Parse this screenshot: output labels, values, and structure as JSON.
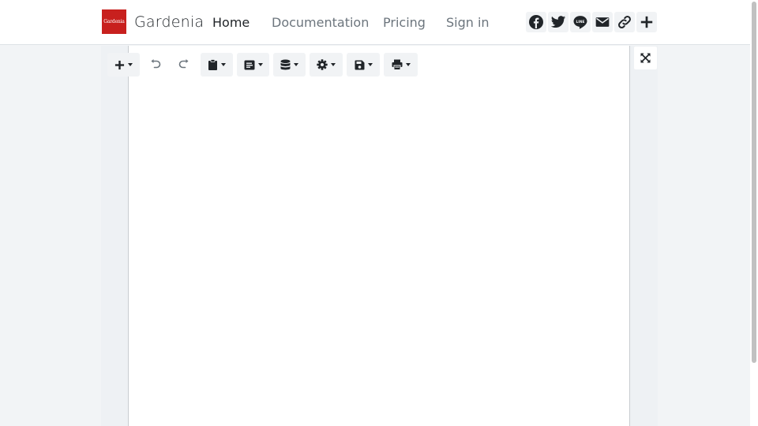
{
  "brand": {
    "logo_text": "Gardenia",
    "name": "Gardenia",
    "logo_color": "#c8201e"
  },
  "nav": [
    {
      "label": "Home",
      "active": true
    },
    {
      "label": "Documentation",
      "active": false
    },
    {
      "label": "Pricing",
      "active": false
    },
    {
      "label": "Sign in",
      "active": false
    }
  ],
  "share_icons": [
    "facebook-icon",
    "twitter-icon",
    "line-icon",
    "email-icon",
    "link-icon",
    "plus-icon"
  ],
  "toolbar": {
    "buttons": [
      {
        "icon": "plus-icon",
        "dropdown": true
      },
      {
        "icon": "undo-icon",
        "dropdown": false
      },
      {
        "icon": "redo-icon",
        "dropdown": false
      },
      {
        "icon": "clipboard-icon",
        "dropdown": true
      },
      {
        "icon": "document-icon",
        "dropdown": true
      },
      {
        "icon": "database-icon",
        "dropdown": true
      },
      {
        "icon": "gear-icon",
        "dropdown": true
      },
      {
        "icon": "save-icon",
        "dropdown": true
      },
      {
        "icon": "print-icon",
        "dropdown": true
      }
    ]
  },
  "fullscreen_icon": "expand-icon",
  "colors": {
    "text_dark": "#212529",
    "text_muted": "#6c757d",
    "page_bg": "#f2f4f6",
    "workspace_bg": "#eef1f4",
    "button_bg": "#f1f3f5"
  }
}
